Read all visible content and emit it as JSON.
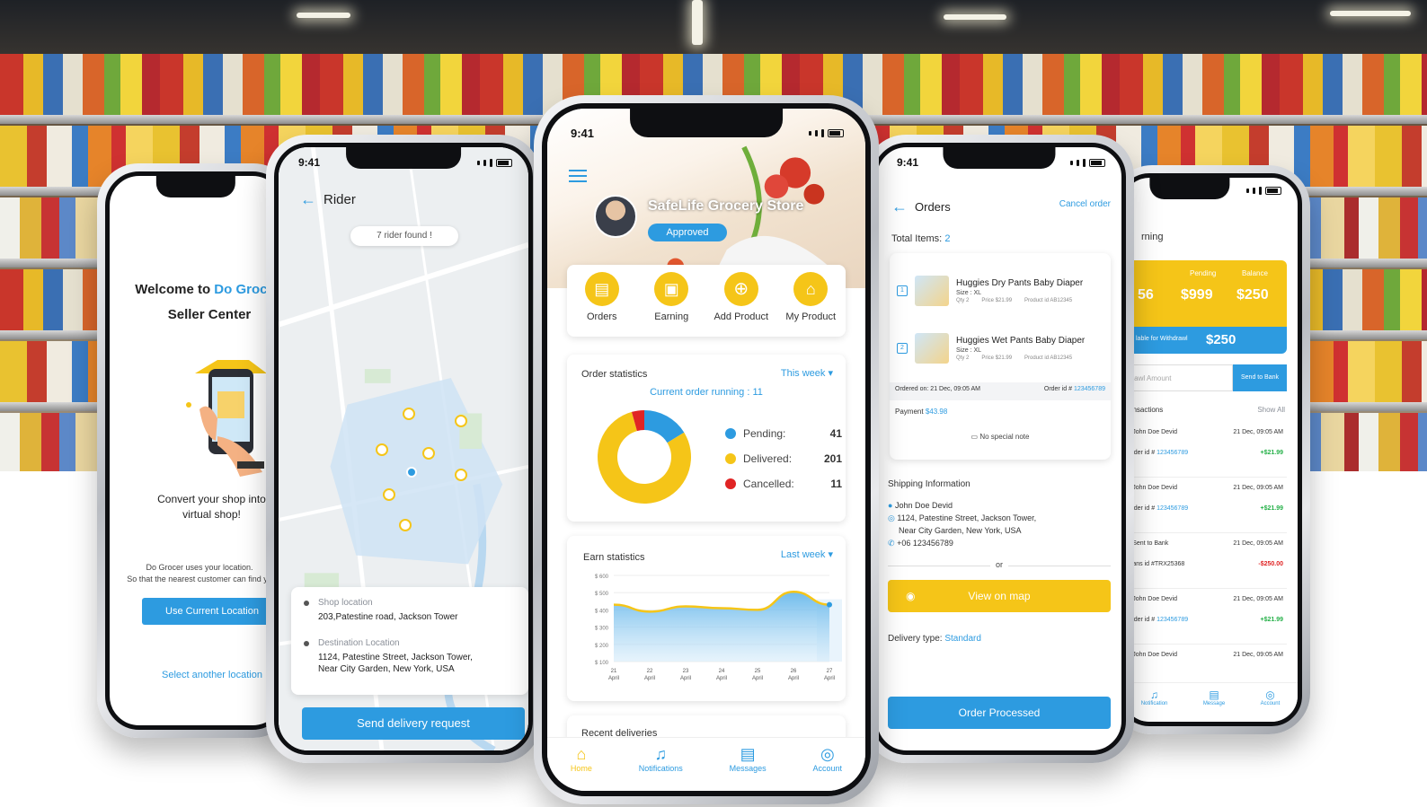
{
  "phone1": {
    "welcome": "Welcome to",
    "brand": "Do Groce",
    "subtitle": "Seller Center",
    "tagline": "Convert your shop into virtual shop!",
    "note_line1": "Do Grocer uses your location.",
    "note_line2": "So that the nearest customer can find yo",
    "use_location": "Use Current Location",
    "select_another": "Select another location"
  },
  "phone2": {
    "time": "9:41",
    "title": "Rider",
    "rider_found": "7 rider found !",
    "shop_label": "Shop location",
    "shop_address": "203,Patestine road, Jackson Tower",
    "dest_label": "Destination Location",
    "dest_line1": "1124, Patestine Street, Jackson Tower,",
    "dest_line2": "Near City Garden, New York, USA",
    "send_request": "Send delivery request"
  },
  "phone3": {
    "time": "9:41",
    "store_name": "SafeLife Grocery Store",
    "approved": "Approved",
    "menu": [
      {
        "label": "Orders",
        "icon": "orders-icon"
      },
      {
        "label": "Earning",
        "icon": "earning-icon"
      },
      {
        "label": "Add Product",
        "icon": "add-product-icon"
      },
      {
        "label": "My Product",
        "icon": "my-product-icon"
      }
    ],
    "order_stats_title": "Order statistics",
    "this_week": "This week",
    "current_running": "Current order running : 11",
    "legend": [
      {
        "label": "Pending:",
        "value": "41",
        "color": "#2d9be0"
      },
      {
        "label": "Delivered:",
        "value": "201",
        "color": "#f5c518"
      },
      {
        "label": "Cancelled:",
        "value": "11",
        "color": "#e02424"
      }
    ],
    "earn_title": "Earn statistics",
    "last_week": "Last week",
    "recent_deliveries": "Recent deliveries",
    "nav": [
      {
        "label": "Home",
        "icon": "home-icon"
      },
      {
        "label": "Notifications",
        "icon": "bell-icon"
      },
      {
        "label": "Messages",
        "icon": "message-icon"
      },
      {
        "label": "Account",
        "icon": "account-icon"
      }
    ]
  },
  "chart_data": [
    {
      "type": "pie",
      "categories": [
        "Pending",
        "Delivered",
        "Cancelled"
      ],
      "values": [
        41,
        201,
        11
      ],
      "title": "Order statistics",
      "colors": [
        "#2d9be0",
        "#f5c518",
        "#e02424"
      ],
      "legend_placement": "right"
    },
    {
      "type": "area",
      "title": "Earn statistics",
      "xlabel": "",
      "ylabel": "",
      "categories": [
        "21 April",
        "22 April",
        "23 April",
        "24 April",
        "25 April",
        "26 April",
        "27 April"
      ],
      "x_tick_top": [
        "21",
        "22",
        "23",
        "24",
        "25",
        "26",
        "27"
      ],
      "x_tick_bottom": [
        "April",
        "April",
        "April",
        "April",
        "April",
        "April",
        "April"
      ],
      "y_ticks": [
        "$ 100",
        "$ 200",
        "$ 300",
        "$ 400",
        "$ 500",
        "$ 600"
      ],
      "ylim": [
        100,
        600
      ],
      "values": [
        430,
        390,
        420,
        410,
        400,
        505,
        430
      ],
      "highlight_index": 6,
      "grid": true
    }
  ],
  "phone4": {
    "time": "9:41",
    "title": "Orders",
    "cancel": "Cancel order",
    "total_label": "Total Items:",
    "total_value": "2",
    "items": [
      {
        "num": "1",
        "name": "Huggies Dry Pants Baby Diaper",
        "size": "Size : XL",
        "qty": "Qty  2",
        "price": "Price  $21.99",
        "product": "Product id  AB12345"
      },
      {
        "num": "2",
        "name": "Huggies Wet Pants Baby Diaper",
        "size": "Size : XL",
        "qty": "Qty  2",
        "price": "Price  $21.99",
        "product": "Product id  AB12345"
      }
    ],
    "ordered_on": "Ordered on: 21 Dec, 09:05 AM",
    "order_id_label": "Order id #",
    "order_id": "123456789",
    "payment_label": "Payment",
    "payment_value": "$43.98",
    "note": "No special note",
    "shipping_title": "Shipping Information",
    "ship_name": "John Doe Devid",
    "ship_addr1": "1124, Patestine Street, Jackson Tower,",
    "ship_addr2": "Near City Garden, New York, USA",
    "ship_phone": "+06 123456789",
    "or": "or",
    "view_map": "View on map",
    "delivery_label": "Delivery type:",
    "delivery_value": "Standard",
    "order_processed": "Order Processed"
  },
  "phone5": {
    "title": "rning",
    "col_pending": "Pending",
    "col_balance": "Balance",
    "val_first": "56",
    "val_pending": "$999",
    "val_balance": "$250",
    "withdraw_label": "lable for Withdrawl",
    "withdraw_value": "$250",
    "amount_placeholder": "drawl Amount",
    "send_bank": "Send to Bank",
    "transactions": "ansactions",
    "show_all": "Show All",
    "rows": [
      {
        "name": "John Doe Devid",
        "date": "21 Dec, 09:05 AM",
        "sub": "Order id #",
        "id": "123456789",
        "amount": "+$21.99",
        "type": "in"
      },
      {
        "name": "John Doe Devid",
        "date": "21 Dec, 09:05 AM",
        "sub": "Order id #",
        "id": "123456789",
        "amount": "+$21.99",
        "type": "in"
      },
      {
        "name": "Sent to Bank",
        "date": "21 Dec, 09:05 AM",
        "sub": "Trans id #TRX25368",
        "id": "",
        "amount": "-$250.00",
        "type": "out"
      },
      {
        "name": "John Doe Devid",
        "date": "21 Dec, 09:05 AM",
        "sub": "Order id #",
        "id": "123456789",
        "amount": "+$21.99",
        "type": "in"
      },
      {
        "name": "John Doe Devid",
        "date": "21 Dec, 09:05 AM",
        "sub": "",
        "id": "",
        "amount": "",
        "type": "in"
      }
    ],
    "nav": [
      "Notification",
      "Message",
      "Account"
    ]
  },
  "colors": {
    "accent_blue": "#2d9be0",
    "accent_yellow": "#f5c518",
    "danger": "#e02424",
    "success": "#27b14a"
  }
}
